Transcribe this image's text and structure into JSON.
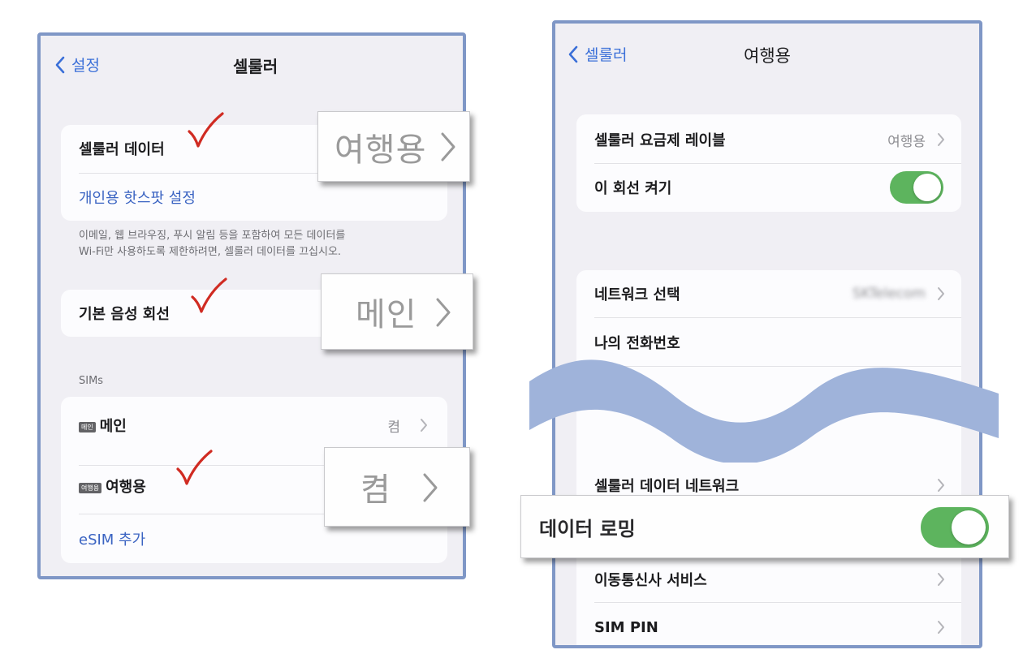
{
  "left": {
    "nav": {
      "back_label": "설정",
      "title": "셀룰러"
    },
    "data_group": {
      "cellular_data_label": "셀룰러 데이터",
      "hotspot_label": "개인용 핫스팟 설정"
    },
    "footnote_line1": "이메일, 웹 브라우징, 푸시 알림 등을 포함하여 모든 데이터를",
    "footnote_line2": "Wi-Fi만 사용하도록 제한하려면, 셀룰러 데이터를 끄십시오.",
    "default_voice_label": "기본 음성 회선",
    "sims_header": "SIMs",
    "sims": [
      {
        "badge": "메인",
        "label": "메인",
        "value": "켬"
      },
      {
        "badge": "여행용",
        "label": "여행용"
      }
    ],
    "add_esim_label": "eSIM 추가",
    "callouts": {
      "data_line": "여행용",
      "voice_line": "메인",
      "sim_status": "켬"
    }
  },
  "right": {
    "nav": {
      "back_label": "셀룰러",
      "title": "여행용"
    },
    "plan_label_row": {
      "label": "셀룰러 요금제 레이블",
      "value": "여행용"
    },
    "line_on_row": {
      "label": "이 회선 켜기",
      "toggle_on": true
    },
    "network_row": {
      "label": "네트워크 선택",
      "value": "SKTelecom"
    },
    "my_number_row": {
      "label": "나의 전화번호"
    },
    "cellular_network_row": {
      "label": "셀룰러 데이터 네트워크"
    },
    "carrier_services_row": {
      "label": "이동통신사 서비스"
    },
    "sim_pin_row": {
      "label": "SIM PIN"
    },
    "roaming_callout": {
      "label": "데이터 로밍",
      "toggle_on": true
    }
  },
  "colors": {
    "accent": "#3a63c2",
    "toggle_on": "#5db45e",
    "frame_border": "#7f97c6",
    "wave": "#9fb3da",
    "checkmark": "#d02b22"
  }
}
